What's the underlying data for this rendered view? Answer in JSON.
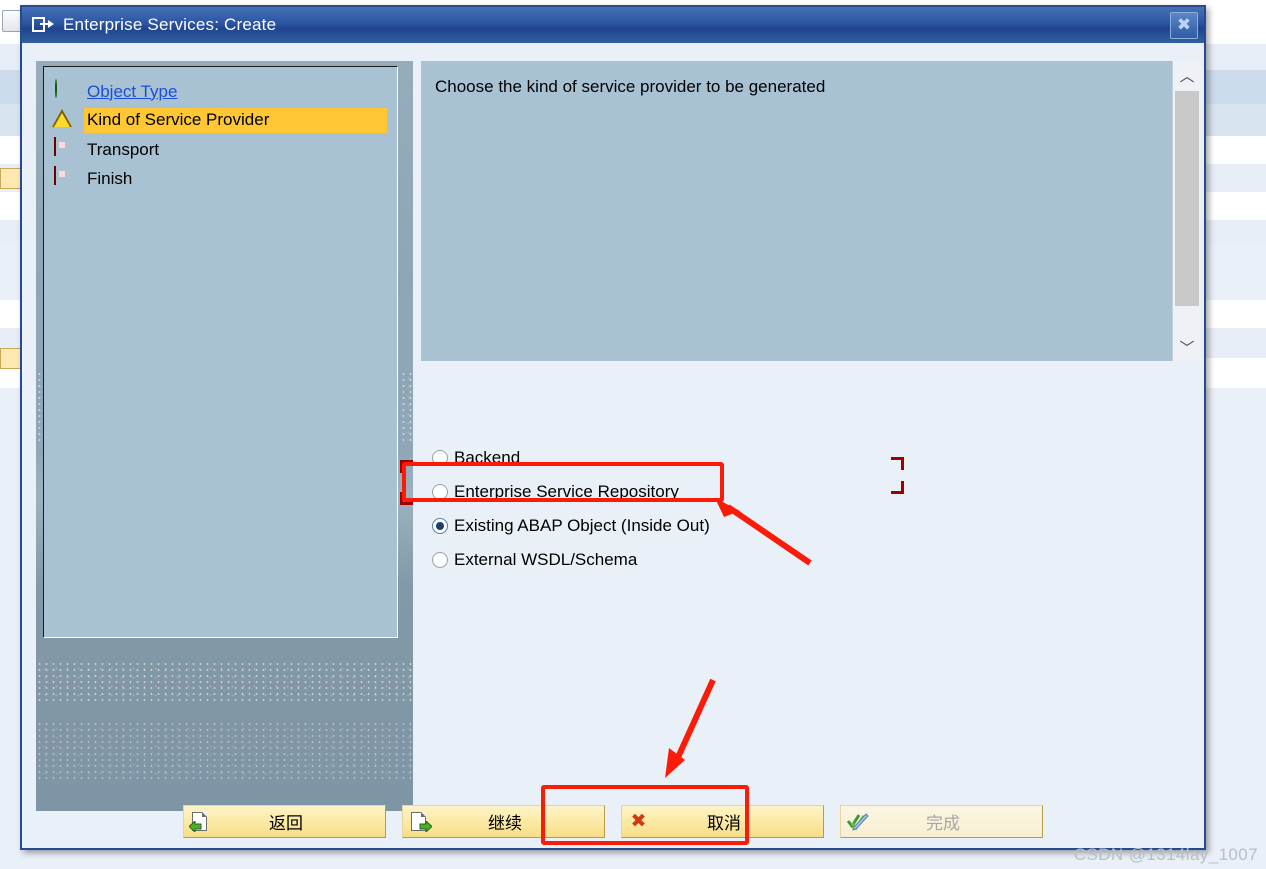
{
  "dialog": {
    "title": "Enterprise Services: Create",
    "title_icon": "enter-box-icon",
    "close_icon": "close-icon"
  },
  "wizard": {
    "steps": [
      {
        "label": "Object Type",
        "icon": "green-circle-icon",
        "state": "done",
        "is_link": true
      },
      {
        "label": "Kind of Service Provider",
        "icon": "yellow-triangle-warning-icon",
        "state": "current",
        "is_link": false
      },
      {
        "label": "Transport",
        "icon": "red-square-icon",
        "state": "pending",
        "is_link": false
      },
      {
        "label": "Finish",
        "icon": "red-square-icon",
        "state": "pending",
        "is_link": false
      }
    ]
  },
  "content": {
    "description": "Choose the kind of service provider to be generated",
    "scrollbar": {
      "up_icon": "chevron-up-icon",
      "down_icon": "chevron-down-icon",
      "thumb": "scroll-thumb"
    },
    "radio_options": [
      {
        "label": "Backend",
        "checked": false
      },
      {
        "label": "Enterprise Service Repository",
        "checked": false
      },
      {
        "label": "Existing ABAP Object (Inside Out)",
        "checked": true
      },
      {
        "label": "External WSDL/Schema",
        "checked": false
      }
    ]
  },
  "footer": {
    "buttons": [
      {
        "label": "返回",
        "icon": "page-back-icon",
        "disabled": false,
        "highlighted": false
      },
      {
        "label": "继续",
        "icon": "page-forward-icon",
        "disabled": false,
        "highlighted": true
      },
      {
        "label": "取消",
        "icon": "cancel-x-icon",
        "disabled": false,
        "highlighted": false
      },
      {
        "label": "完成",
        "icon": "check-pen-icon",
        "disabled": true,
        "highlighted": false
      }
    ]
  },
  "annotations": {
    "radio_highlight_color": "#fb1b09",
    "corner_mark_color": "#9e0000",
    "arrow_color": "#fb1b09"
  },
  "watermark": "CSDN @1314lay_1007"
}
